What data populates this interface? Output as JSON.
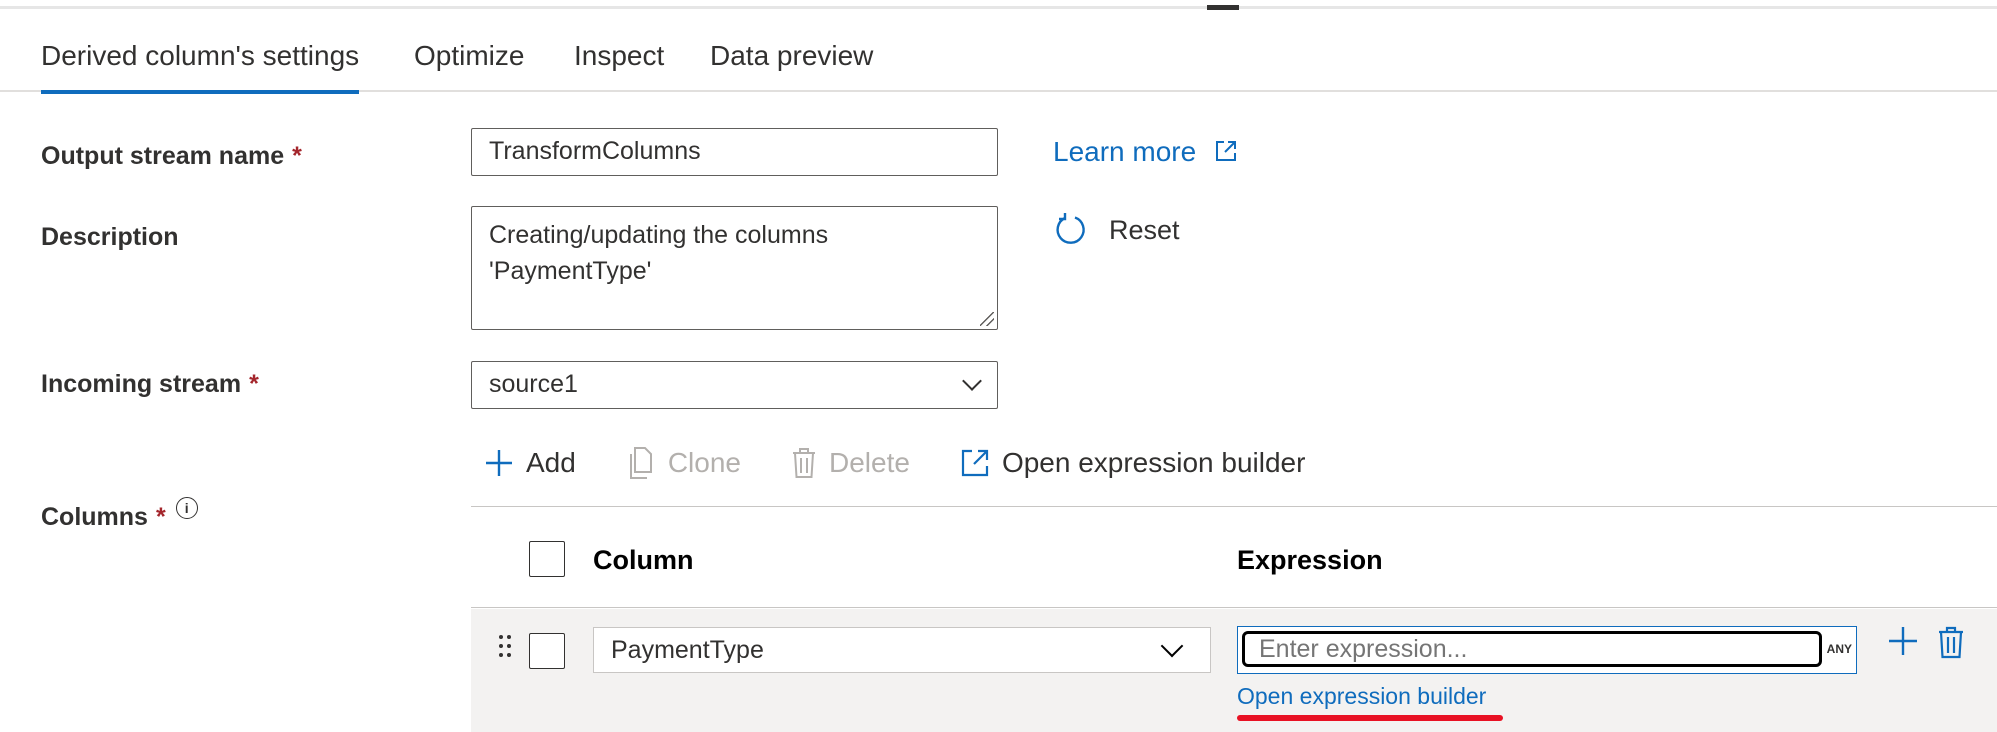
{
  "tabs": [
    {
      "label": "Derived column's settings",
      "active": true
    },
    {
      "label": "Optimize",
      "active": false
    },
    {
      "label": "Inspect",
      "active": false
    },
    {
      "label": "Data preview",
      "active": false
    }
  ],
  "form": {
    "output_stream": {
      "label": "Output stream name",
      "required_mark": "*",
      "value": "TransformColumns"
    },
    "description": {
      "label": "Description",
      "value": "Creating/updating the columns 'PaymentType'"
    },
    "incoming_stream": {
      "label": "Incoming stream",
      "required_mark": "*",
      "value": "source1"
    },
    "columns": {
      "label": "Columns",
      "required_mark": "*",
      "info_glyph": "i"
    }
  },
  "links": {
    "learn_more": "Learn more",
    "reset": "Reset"
  },
  "toolbar": {
    "add": "Add",
    "clone": "Clone",
    "delete": "Delete",
    "open_builder": "Open expression builder"
  },
  "grid": {
    "headers": {
      "column": "Column",
      "expression": "Expression"
    },
    "rows": [
      {
        "column": "PaymentType",
        "expression_placeholder": "Enter expression...",
        "type_badge": "ANY",
        "open_builder_link": "Open expression builder"
      }
    ]
  },
  "colors": {
    "accent": "#0f6cbd",
    "required": "#a4262c",
    "annotation": "#e81123"
  },
  "icons": [
    "external-link-icon",
    "reset-icon",
    "plus-icon",
    "clone-icon",
    "trash-icon",
    "drag-handle-icon",
    "chevron-down-icon",
    "info-icon"
  ]
}
